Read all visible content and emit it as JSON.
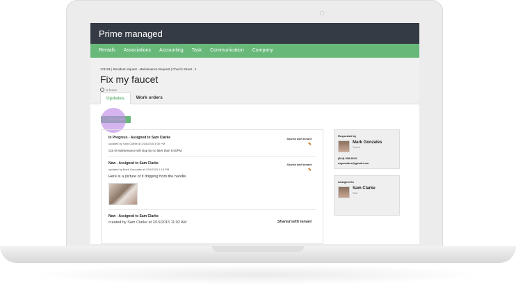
{
  "app": {
    "title": "Prime managed"
  },
  "nav": [
    "Rentals",
    "Associations",
    "Accounting",
    "Task",
    "Communication",
    "Company"
  ],
  "header": {
    "breadcrumb": "174191 | Resident request - Maintenance Request | Church Street - 2",
    "title": "Fix my faucet",
    "time": "6 hours"
  },
  "tabs": [
    "Updates",
    "Work orders"
  ],
  "update_button": "Update task",
  "feed": [
    {
      "heading": "In Progress - Assigned to Sam Clarke",
      "byline": "updated by Sam Clarke at 2/15/2015 4:00 PM",
      "text": "Got it! Maintenance will stop by no later than 5:00PM.",
      "shared": "Shared with tenant"
    },
    {
      "heading": "New - Assigned to Sam Clarke",
      "byline": "updated by Mark Gonzales at 2/15/2015 1:15 PM",
      "text": "Here is a picture of it dripping from the handle.",
      "shared": "Shared with tenant"
    },
    {
      "heading": "New - Assigned to Sam Clarke",
      "byline": "created by Sam Clarke at 2/15/2015 11:02 AM",
      "shared": "Shared with tenant"
    }
  ],
  "requested_by": {
    "label": "Requested by",
    "name": "Mark Gonzales",
    "role": "Tenant",
    "phone": "(814) 338-8210",
    "email": "mgonzales@gmail.com"
  },
  "assigned_to": {
    "label": "Assigned to",
    "name": "Sam Clarke",
    "role": "Staff"
  }
}
